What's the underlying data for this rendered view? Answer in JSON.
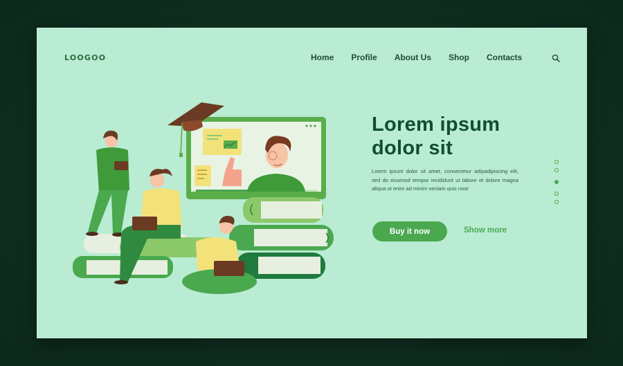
{
  "brand": {
    "logo": "LOOGOO"
  },
  "nav": {
    "items": [
      "Home",
      "Profile",
      "About Us",
      "Shop",
      "Contacts"
    ]
  },
  "icons": {
    "search": "search-icon"
  },
  "hero": {
    "headline_line1": "Lorem ipsum",
    "headline_line2": "dolor sit",
    "body": "Lorem ipsum dolor sit amet, consectetur adipadipiscing elit, sed do eiusmod tempor incididunt ut labore et dolore magna aliqua ut enim ad minim veniam quis nost",
    "primary_button": "Buy it now",
    "secondary_link": "Show more"
  },
  "pagination": {
    "count": 5,
    "active_index": 3
  },
  "colors": {
    "page_background": "#b9ecd3",
    "accent": "#4aa84f",
    "headline": "#114d33",
    "frame": "#0f2d20"
  }
}
